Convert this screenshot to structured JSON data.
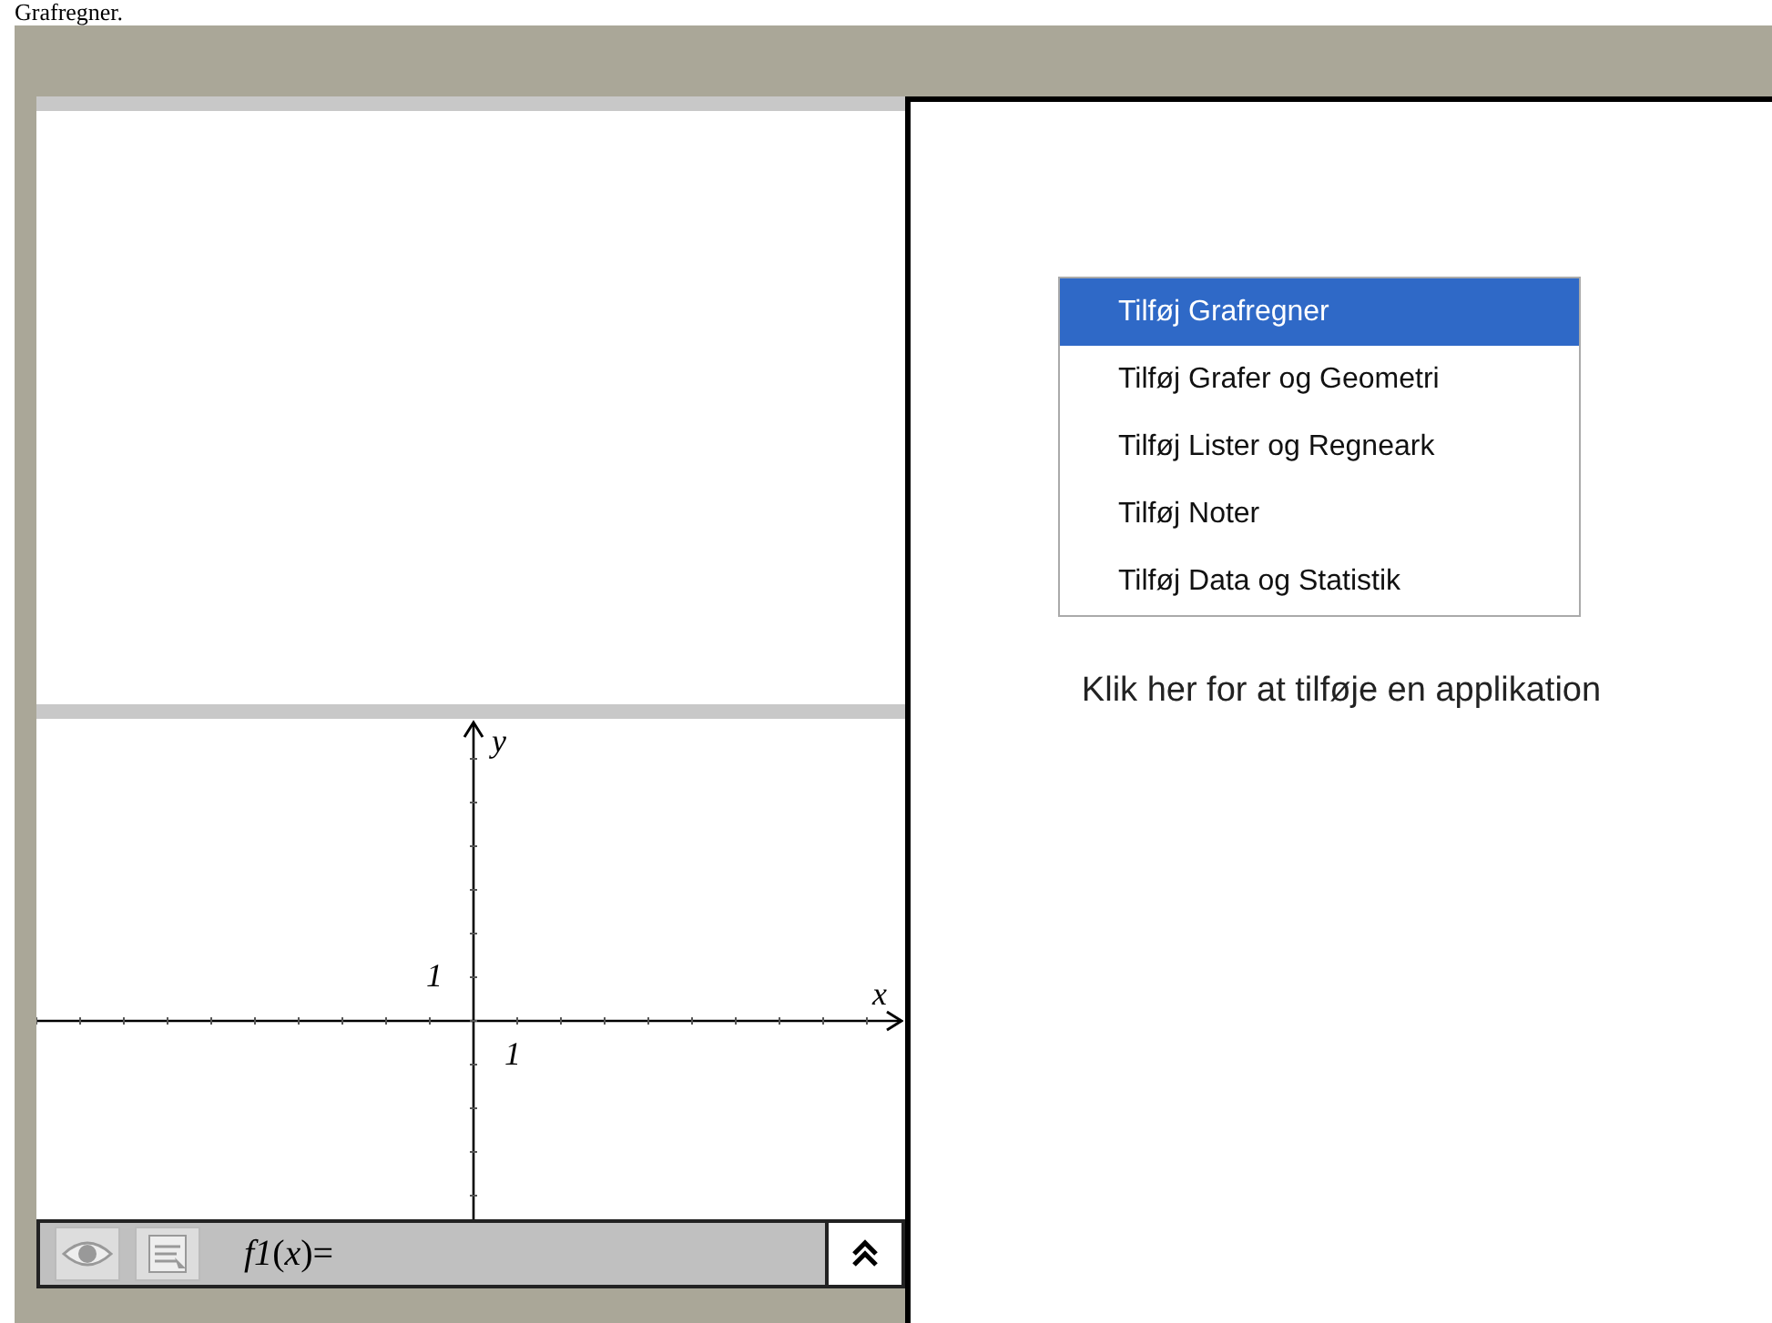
{
  "caption": "Grafregner.",
  "graph": {
    "x_label": "x",
    "y_label": "y",
    "x_tick_label": "1",
    "y_tick_label": "1"
  },
  "entry_bar": {
    "formula": "*f1*(*x*)="
  },
  "menu": {
    "items": [
      {
        "label": "Tilføj Grafregner",
        "selected": true
      },
      {
        "label": "Tilføj Grafer og Geometri",
        "selected": false
      },
      {
        "label": "Tilføj Lister og Regneark",
        "selected": false
      },
      {
        "label": "Tilføj Noter",
        "selected": false
      },
      {
        "label": "Tilføj Data og Statistik",
        "selected": false
      }
    ]
  },
  "hint": "Klik her for at tilføje en applikation"
}
